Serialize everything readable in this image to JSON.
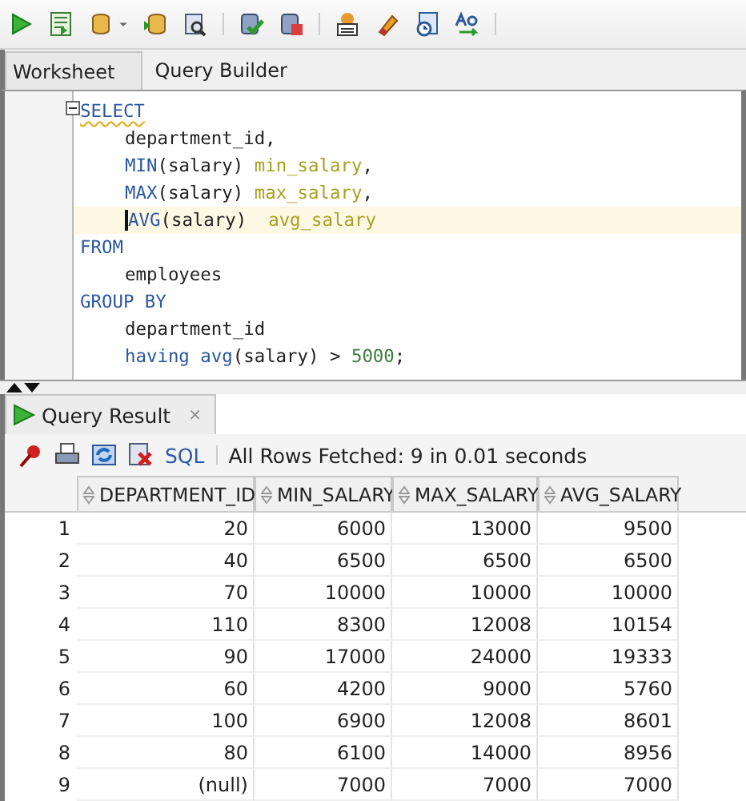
{
  "editor_tabs": [
    {
      "label": "Worksheet",
      "selected": true
    },
    {
      "label": "Query Builder",
      "selected": false
    }
  ],
  "code_lines": [
    {
      "indented": false,
      "current": false,
      "tokens": [
        {
          "kind": "keyword",
          "text": "SELECT"
        }
      ]
    },
    {
      "indented": true,
      "current": false,
      "tokens": [
        {
          "kind": "plain",
          "text": "department_id,"
        }
      ]
    },
    {
      "indented": true,
      "current": false,
      "tokens": [
        {
          "kind": "keyword",
          "text": "MIN"
        },
        {
          "kind": "plain",
          "text": "(salary) "
        },
        {
          "kind": "alias",
          "text": "min_salary"
        },
        {
          "kind": "plain",
          "text": ","
        }
      ]
    },
    {
      "indented": true,
      "current": false,
      "tokens": [
        {
          "kind": "keyword",
          "text": "MAX"
        },
        {
          "kind": "plain",
          "text": "(salary) "
        },
        {
          "kind": "alias",
          "text": "max_salary"
        },
        {
          "kind": "plain",
          "text": ","
        }
      ]
    },
    {
      "indented": true,
      "current": true,
      "tokens": [
        {
          "kind": "keyword",
          "text": "AVG"
        },
        {
          "kind": "plain",
          "text": "(salary)  "
        },
        {
          "kind": "alias",
          "text": "avg_salary"
        }
      ]
    },
    {
      "indented": false,
      "current": false,
      "tokens": [
        {
          "kind": "keyword",
          "text": "FROM"
        }
      ]
    },
    {
      "indented": true,
      "current": false,
      "tokens": [
        {
          "kind": "plain",
          "text": "employees"
        }
      ]
    },
    {
      "indented": false,
      "current": false,
      "tokens": [
        {
          "kind": "keyword",
          "text": "GROUP BY"
        }
      ]
    },
    {
      "indented": true,
      "current": false,
      "tokens": [
        {
          "kind": "plain",
          "text": "department_id"
        }
      ]
    },
    {
      "indented": true,
      "current": false,
      "tokens": [
        {
          "kind": "keyword",
          "text": "having avg"
        },
        {
          "kind": "plain",
          "text": "(salary) > "
        },
        {
          "kind": "number",
          "text": "5000"
        },
        {
          "kind": "plain",
          "text": ";"
        }
      ]
    }
  ],
  "result_tab": {
    "label": "Query Result",
    "close": "×"
  },
  "result_toolbar": {
    "sql_link": "SQL",
    "status": "All Rows Fetched: 9 in 0.01 seconds"
  },
  "table": {
    "columns": [
      "DEPARTMENT_ID",
      "MIN_SALARY",
      "MAX_SALARY",
      "AVG_SALARY"
    ],
    "rows": [
      {
        "number": "1",
        "selected": false,
        "cells": [
          "20",
          "6000",
          "13000",
          "9500"
        ]
      },
      {
        "number": "2",
        "selected": false,
        "cells": [
          "40",
          "6500",
          "6500",
          "6500"
        ]
      },
      {
        "number": "3",
        "selected": false,
        "cells": [
          "70",
          "10000",
          "10000",
          "10000"
        ]
      },
      {
        "number": "4",
        "selected": false,
        "cells": [
          "110",
          "8300",
          "12008",
          "10154"
        ]
      },
      {
        "number": "5",
        "selected": false,
        "cells": [
          "90",
          "17000",
          "24000",
          "19333"
        ]
      },
      {
        "number": "6",
        "selected": false,
        "cells": [
          "60",
          "4200",
          "9000",
          "5760"
        ]
      },
      {
        "number": "7",
        "selected": false,
        "cells": [
          "100",
          "6900",
          "12008",
          "8601"
        ]
      },
      {
        "number": "8",
        "selected": false,
        "cells": [
          "80",
          "6100",
          "14000",
          "8956"
        ]
      },
      {
        "number": "9",
        "selected": false,
        "cells": [
          "(null)",
          "7000",
          "7000",
          "7000"
        ]
      }
    ]
  }
}
